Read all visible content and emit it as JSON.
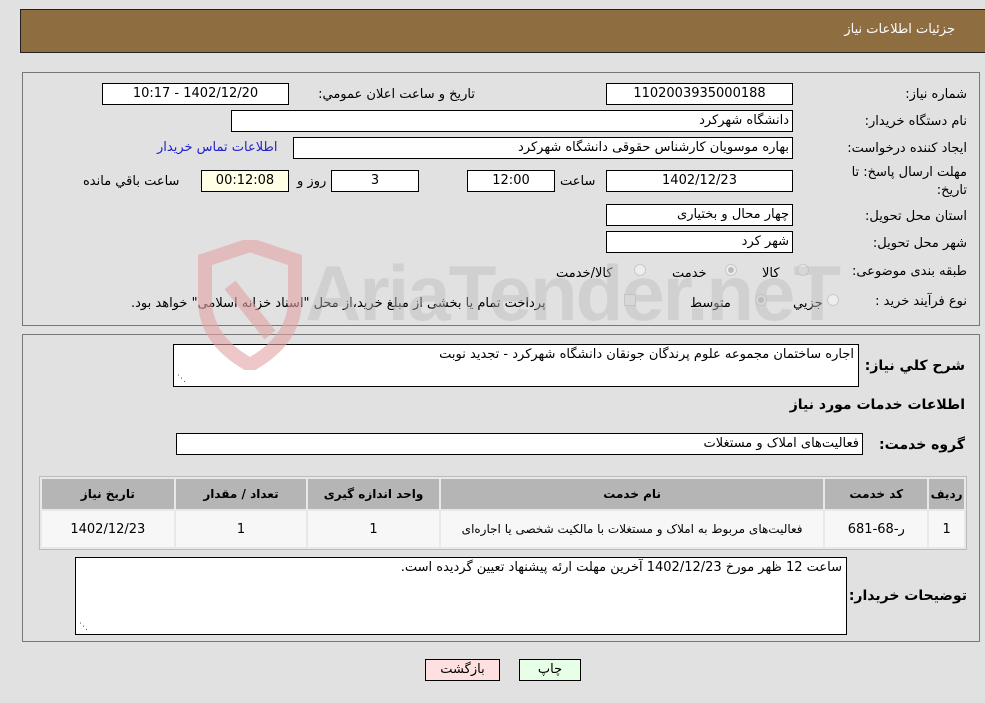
{
  "header": {
    "title": "جزئیات اطلاعات نیاز"
  },
  "form": {
    "need_number": {
      "label": "شماره نیاز:",
      "value": "1102003935000188"
    },
    "announce_datetime": {
      "label": "تاریخ و ساعت اعلان عمومي:",
      "value": "1402/12/20 - 10:17"
    },
    "buyer_org": {
      "label": "نام دستگاه خریدار:",
      "value": "دانشگاه شهرکرد"
    },
    "requester": {
      "label": "ایجاد کننده درخواست:",
      "value": "بهاره موسویان کارشناس حقوقی دانشگاه شهرکرد"
    },
    "buyer_contact_link": "اطلاعات تماس خریدار",
    "deadline": {
      "label_line1": "مهلت ارسال پاسخ: تا",
      "label_line2": "تاریخ:",
      "date": "1402/12/23",
      "time_label": "ساعت",
      "time": "12:00",
      "days": "3",
      "days_label": "روز و",
      "remaining": "00:12:08",
      "remaining_label": "ساعت باقي مانده"
    },
    "province": {
      "label": "استان محل تحویل:",
      "value": "چهار محال و بختیاری"
    },
    "city": {
      "label": "شهر محل تحویل:",
      "value": "شهر کرد"
    },
    "category": {
      "label": "طبقه بندی موضوعی:",
      "options": [
        "کالا",
        "خدمت",
        "کالا/خدمت"
      ],
      "selected": "خدمت"
    },
    "purchase_type": {
      "label": "نوع فرآیند خرید :",
      "options": [
        "جزيي",
        "متوسط"
      ],
      "selected": "متوسط",
      "treasury_note": "پرداخت تمام یا بخشی از مبلغ خرید،از محل \"اسناد خزانه اسلامی\" خواهد بود."
    }
  },
  "details": {
    "description_label": "شرح کلي نیاز:",
    "description_value": "اجاره ساختمان مجموعه علوم پرندگان جونقان دانشگاه شهرکرد - تجدید نوبت",
    "services_heading": "اطلاعات خدمات مورد نیاز",
    "service_group_label": "گروه خدمت:",
    "service_group_value": "فعالیت‌های  املاک و مستغلات",
    "table": {
      "headers": [
        "ردیف",
        "کد خدمت",
        "نام خدمت",
        "واحد اندازه گیری",
        "تعداد / مقدار",
        "تاریخ نیاز"
      ],
      "rows": [
        [
          "1",
          "ر-68-681",
          "فعالیت‌های مربوط به املاک و مستغلات با مالکیت شخصی یا اجاره‌ای",
          "1",
          "1",
          "1402/12/23"
        ]
      ]
    },
    "buyer_notes_label": "توضیحات خریدار:",
    "buyer_notes_value": "ساعت 12 ظهر مورخ 1402/12/23 آخرین مهلت ارئه پیشنهاد تعیین گردیده است."
  },
  "buttons": {
    "print": "چاپ",
    "back": "بازگشت"
  },
  "watermark": {
    "text": "AriaTender.neT"
  },
  "colors": {
    "header_bg": "#8e6d41",
    "link": "#2222cc",
    "print_bg": "#e6ffe6",
    "back_bg": "#ffe0e0",
    "remaining_bg": "#ffffe6"
  }
}
